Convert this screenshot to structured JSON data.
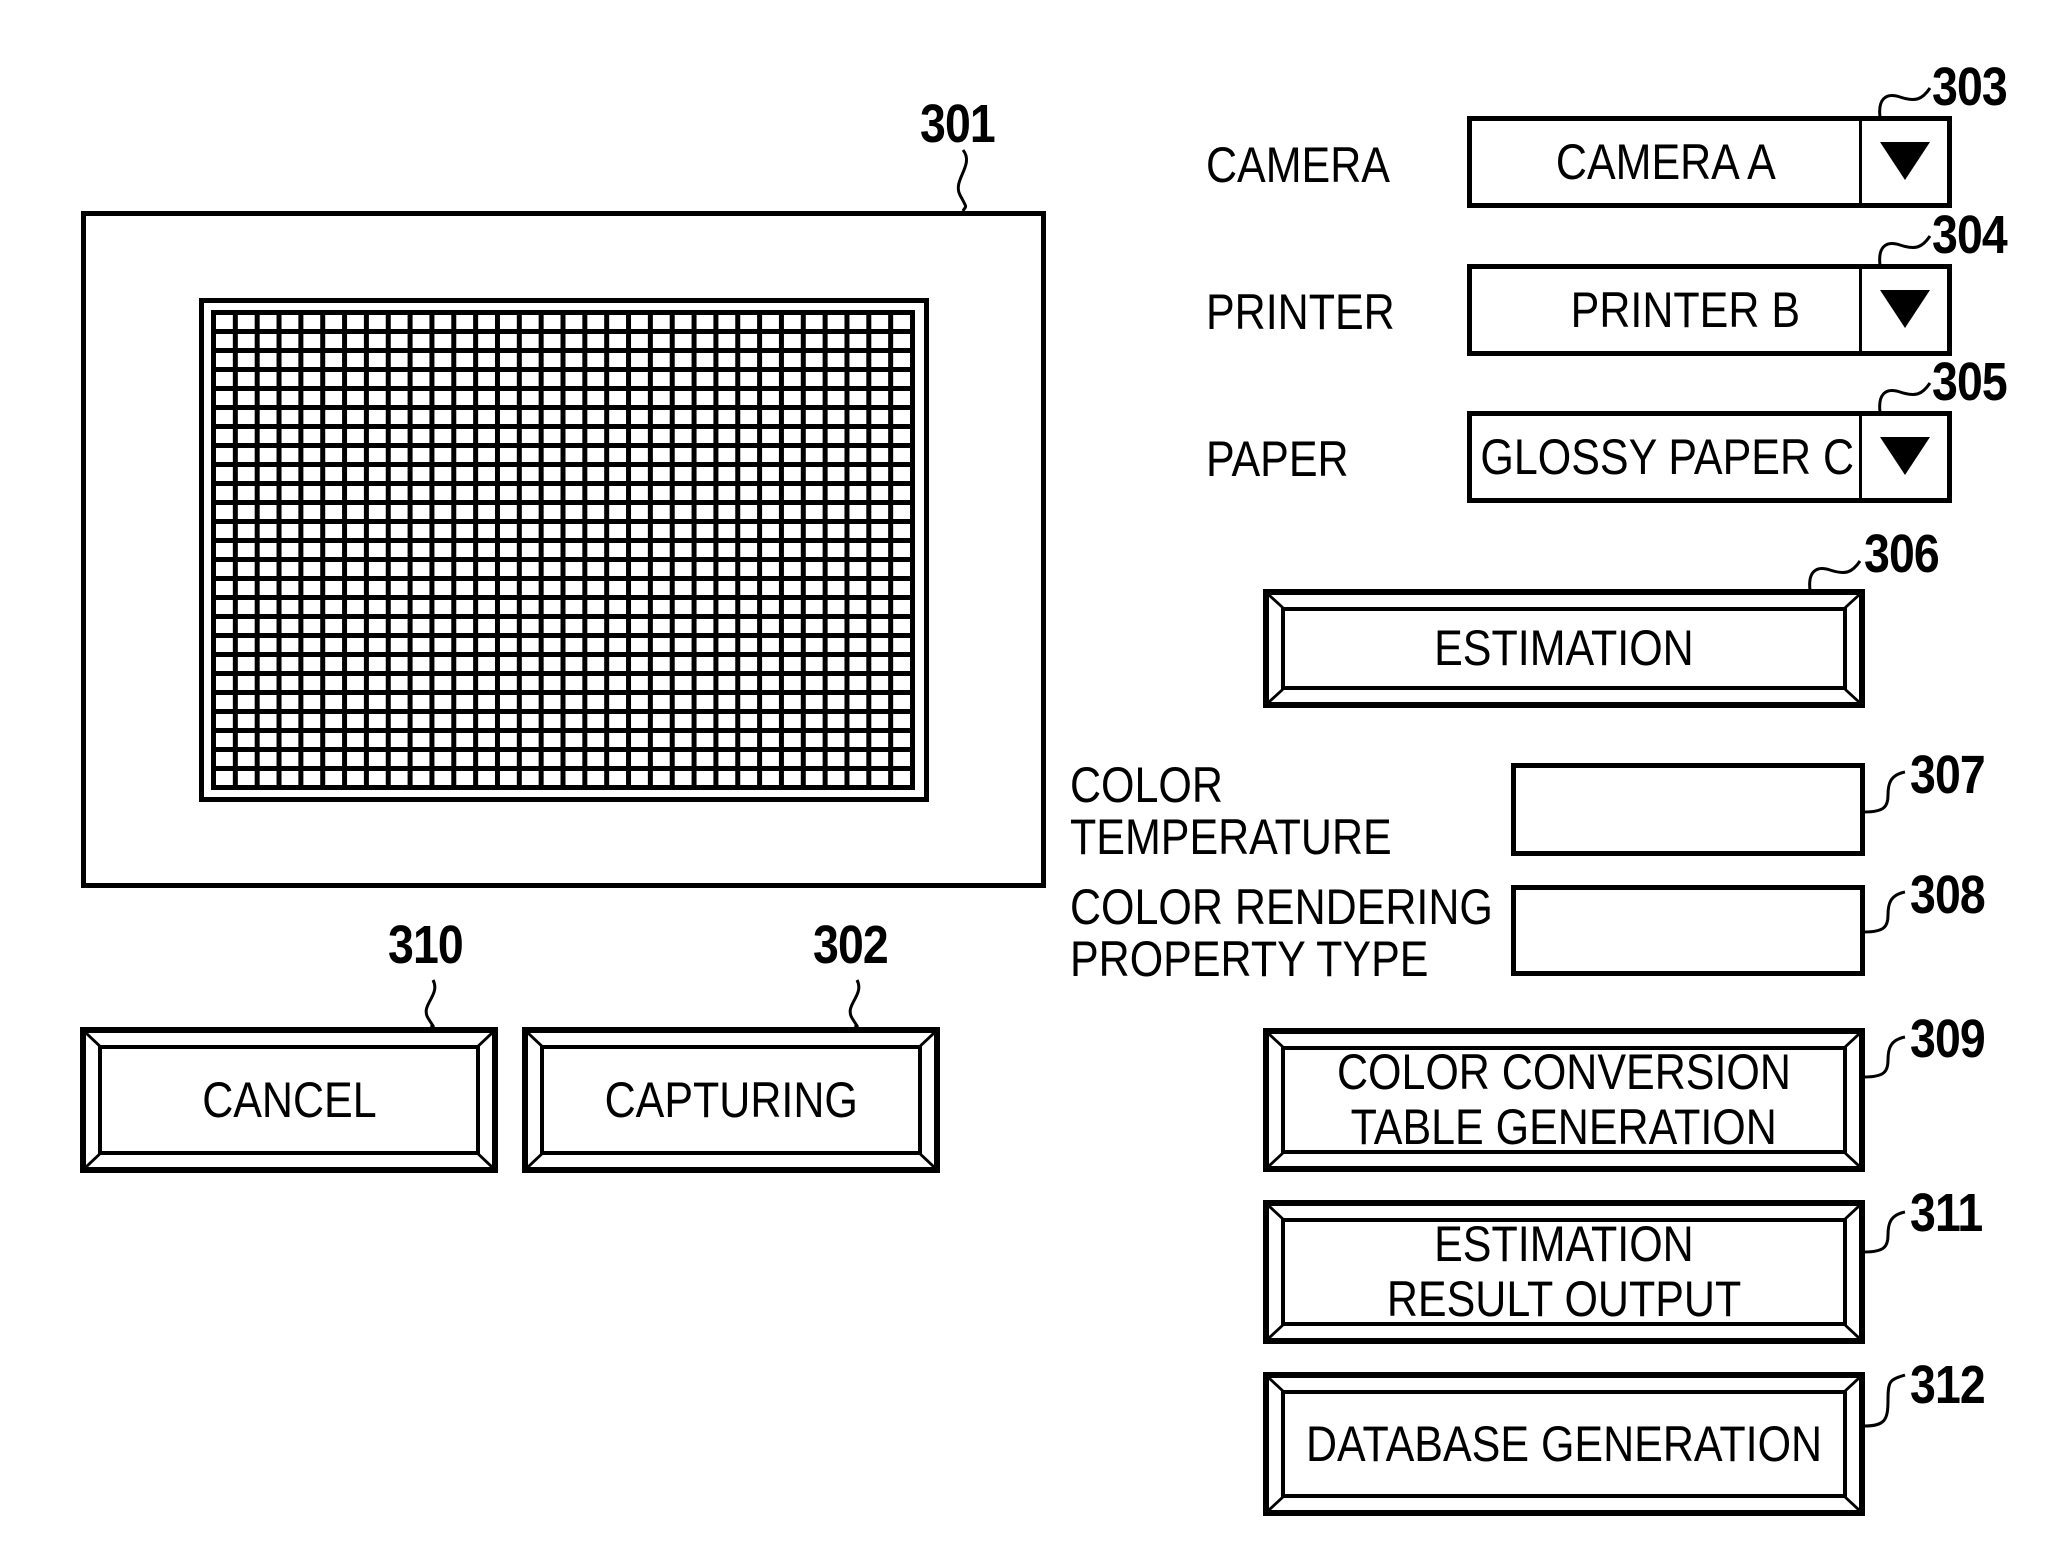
{
  "preview": {
    "ref": "301",
    "target_grid": {
      "columns": 32,
      "rows": 25
    }
  },
  "left_buttons": [
    {
      "id": "cancel",
      "ref": "310",
      "label": "CANCEL"
    },
    {
      "id": "capturing",
      "ref": "302",
      "label": "CAPTURING"
    }
  ],
  "settings": [
    {
      "id": "camera",
      "ref": "303",
      "label": "CAMERA",
      "value": "CAMERA A",
      "icon": "triangle-down-icon"
    },
    {
      "id": "printer",
      "ref": "304",
      "label": "PRINTER",
      "value": "PRINTER B",
      "icon": "triangle-down-icon"
    },
    {
      "id": "paper",
      "ref": "305",
      "label": "PAPER",
      "value": "GLOSSY PAPER C",
      "icon": "triangle-down-icon"
    }
  ],
  "estimation_button": {
    "ref": "306",
    "label": "ESTIMATION"
  },
  "results": [
    {
      "id": "color-temperature",
      "ref": "307",
      "label_lines": [
        "COLOR",
        "TEMPERATURE"
      ],
      "value": ""
    },
    {
      "id": "color-rendering-property-type",
      "ref": "308",
      "label_lines": [
        "COLOR RENDERING",
        "PROPERTY TYPE"
      ],
      "value": ""
    }
  ],
  "action_buttons": [
    {
      "id": "color-conversion-table-generation",
      "ref": "309",
      "label_lines": [
        "COLOR CONVERSION",
        "TABLE GENERATION"
      ]
    },
    {
      "id": "estimation-result-output",
      "ref": "311",
      "label_lines": [
        "ESTIMATION",
        "RESULT OUTPUT"
      ]
    },
    {
      "id": "database-generation",
      "ref": "312",
      "label_lines": [
        "DATABASE GENERATION"
      ]
    }
  ]
}
